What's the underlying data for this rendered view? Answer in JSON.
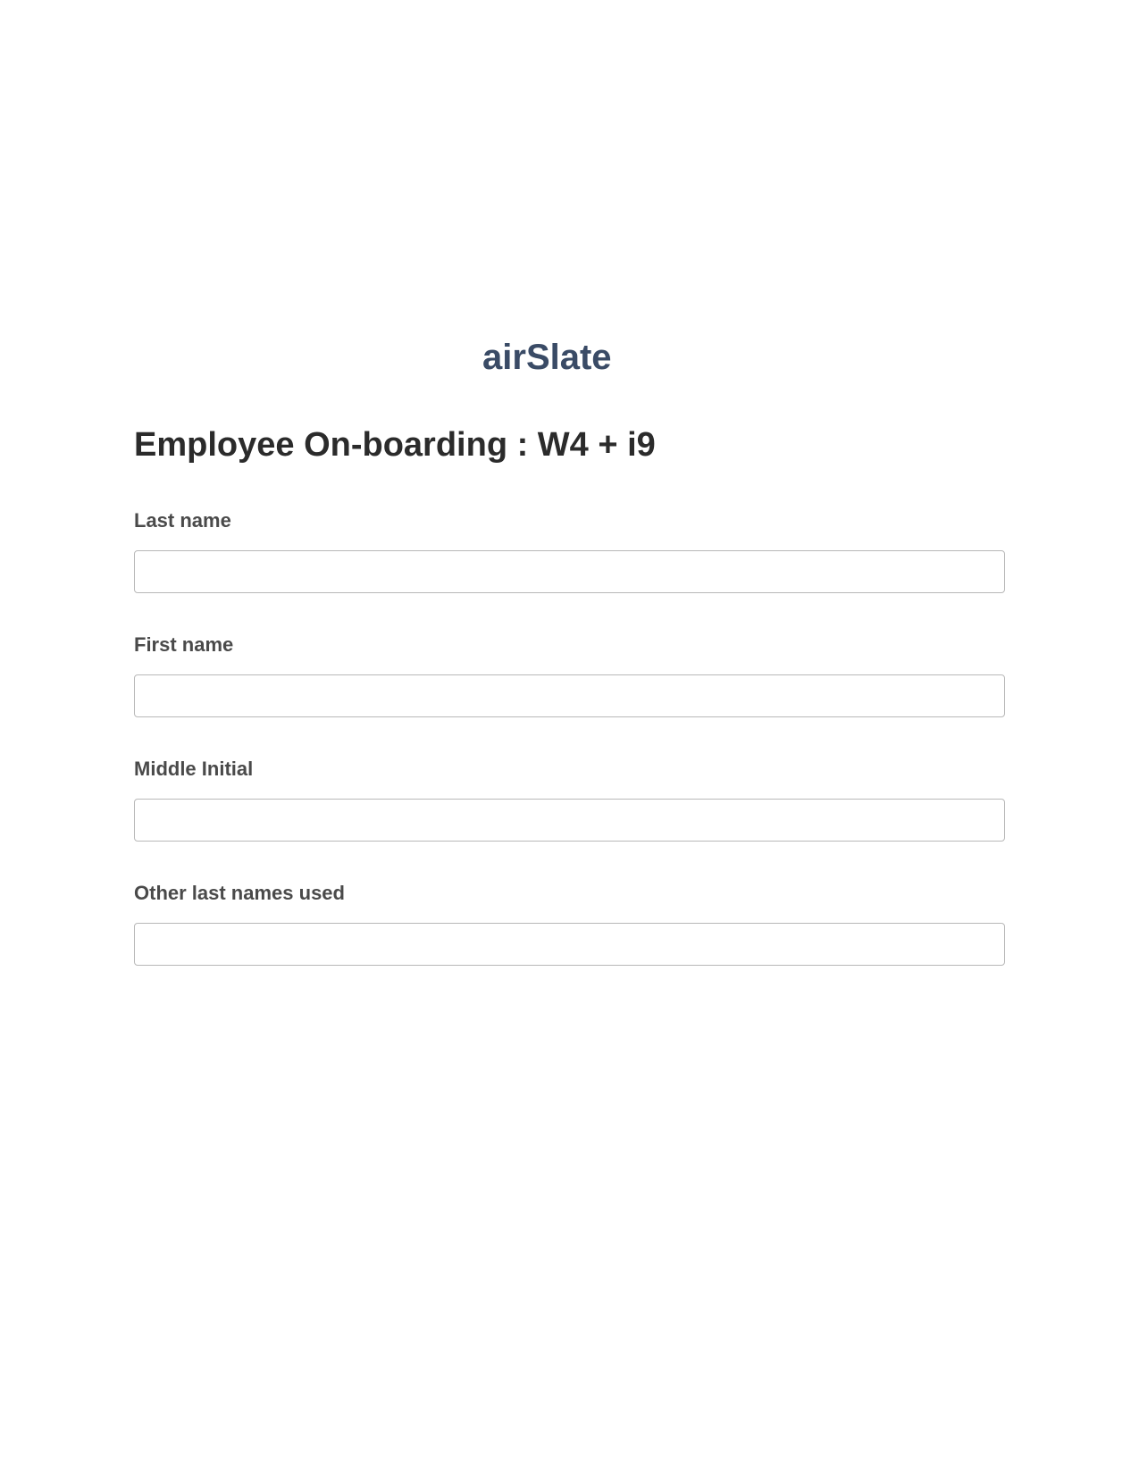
{
  "brand": {
    "name": "airSlate",
    "color": "#3a4b66"
  },
  "form": {
    "title": "Employee On-boarding : W4 + i9",
    "fields": [
      {
        "label": "Last name",
        "value": ""
      },
      {
        "label": "First name",
        "value": ""
      },
      {
        "label": "Middle Initial",
        "value": ""
      },
      {
        "label": "Other last names used",
        "value": ""
      }
    ]
  }
}
